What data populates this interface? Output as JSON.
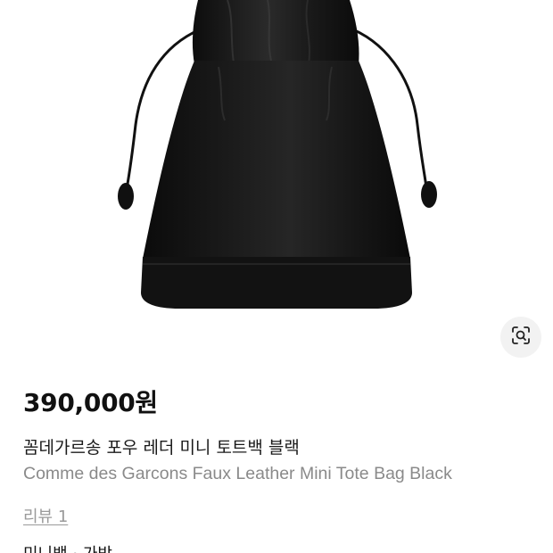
{
  "product": {
    "price": "390,000원",
    "name_ko": "꼼데가르송 포우 레더 미니 토트백 블랙",
    "name_en": "Comme des Garcons Faux Leather Mini Tote Bag Black",
    "review_link": "리뷰 1",
    "category_path": "미니백 · 가방"
  },
  "icons": {
    "lens": "image-search-lens-icon"
  },
  "colors": {
    "bag": "#131313",
    "lens_button_bg": "#f2f2f2",
    "secondary_text": "#8a8a8a"
  }
}
